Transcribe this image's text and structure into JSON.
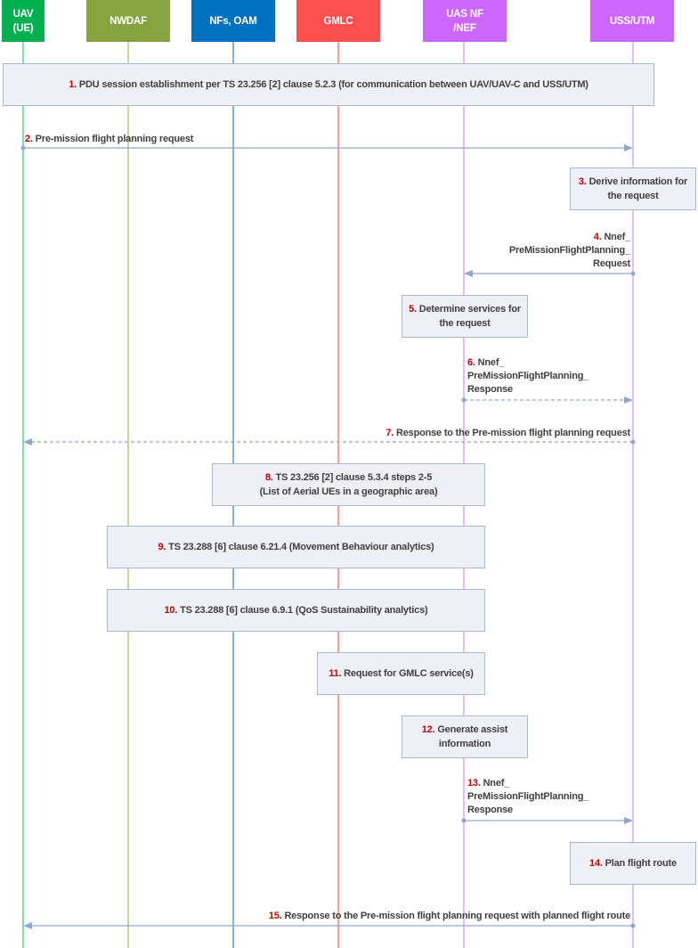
{
  "participants": [
    {
      "label": "UAV\n(UE)",
      "color": "#00b050",
      "line": "#5ccf8a"
    },
    {
      "label": "NWDAF",
      "color": "#86a340",
      "line": "#aec884"
    },
    {
      "label": "NFs, OAM",
      "color": "#0070c0",
      "line": "#5b9bd5"
    },
    {
      "label": "GMLC",
      "color": "#ff5050",
      "line": "#ff7c7c"
    },
    {
      "label": "UAS NF\n/NEF",
      "color": "#cc66ff",
      "line": "#e2a3fb"
    },
    {
      "label": "USS/UTM",
      "color": "#cc66ff",
      "line": "#e2a3fb"
    }
  ],
  "steps": {
    "s1": {
      "num": "1.",
      "text": "PDU session establishment per TS 23.256 [2] clause 5.2.3 (for communication between UAV/UAV-C and USS/UTM)"
    },
    "s2": {
      "num": "2.",
      "text": "Pre-mission flight planning request"
    },
    "s3": {
      "num": "3.",
      "text": "Derive information for the request"
    },
    "s4": {
      "num": "4.",
      "line1": "Nnef_",
      "line2": "PreMissionFlightPlanning_",
      "line3": "Request"
    },
    "s5": {
      "num": "5.",
      "text": "Determine services for the request"
    },
    "s6": {
      "num": "6.",
      "line1": "Nnef_",
      "line2": "PreMissionFlightPlanning_",
      "line3": "Response"
    },
    "s7": {
      "num": "7.",
      "text": "Response to the Pre-mission flight planning request"
    },
    "s8": {
      "num": "8.",
      "line1": "TS 23.256 [2] clause 5.3.4 steps 2-5",
      "line2": "(List of Aerial UEs in a geographic area)"
    },
    "s9": {
      "num": "9.",
      "text": "TS 23.288 [6] clause 6.21.4 (Movement Behaviour analytics)"
    },
    "s10": {
      "num": "10.",
      "text": "TS 23.288 [6] clause 6.9.1 (QoS Sustainability analytics)"
    },
    "s11": {
      "num": "11.",
      "text": "Request for GMLC service(s)"
    },
    "s12": {
      "num": "12.",
      "text": "Generate assist information"
    },
    "s13": {
      "num": "13.",
      "line1": "Nnef_",
      "line2": "PreMissionFlightPlanning_",
      "line3": "Response"
    },
    "s14": {
      "num": "14.",
      "text": "Plan flight route"
    },
    "s15": {
      "num": "15.",
      "text": "Response to the Pre-mission flight planning request with planned flight route"
    }
  },
  "colors": {
    "step_number": "#c00000",
    "arrow": "#8fa7cc",
    "box_fill": "#eef0f5",
    "box_border": "#a9b8d0"
  }
}
